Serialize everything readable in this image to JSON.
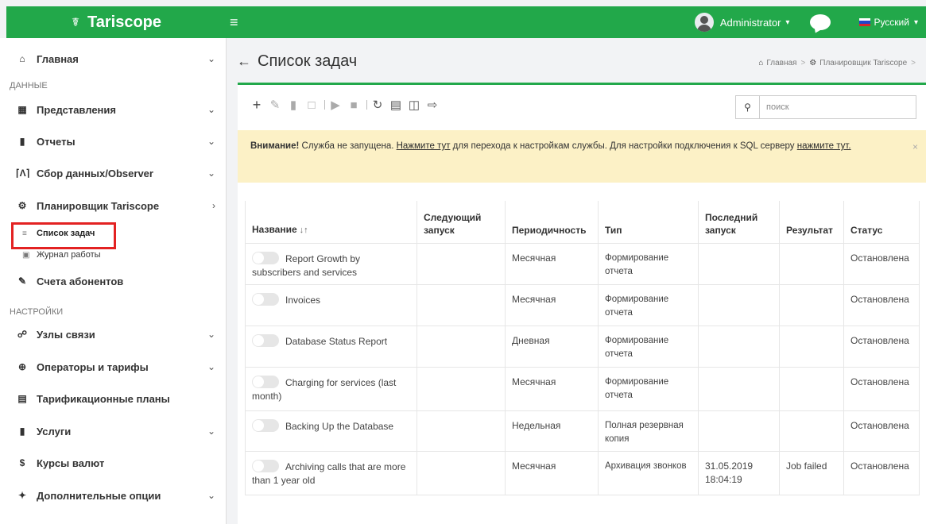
{
  "brand": {
    "name": "Tariscope",
    "glyph": "☤"
  },
  "topbar": {
    "menu_glyph": "≡",
    "user_name": "Administrator",
    "language": "Русский",
    "caret": "▾"
  },
  "sidebar": {
    "home": {
      "label": "Главная",
      "icon": "home-icon"
    },
    "section_data": "ДАННЫЕ",
    "views": {
      "label": "Представления",
      "icon": "table-icon"
    },
    "reports": {
      "label": "Отчеты",
      "icon": "book-icon"
    },
    "collection": {
      "label": "Сбор данных/Observer",
      "icon": "antenna-icon"
    },
    "scheduler": {
      "label": "Планировщик Tariscope",
      "icon": "cogs-icon"
    },
    "task_list": {
      "label": "Список задач",
      "icon": "list-icon"
    },
    "work_log": {
      "label": "Журнал работы",
      "icon": "log-icon"
    },
    "accounts": {
      "label": "Счета абонентов",
      "icon": "invoice-icon"
    },
    "section_settings": "НАСТРОЙКИ",
    "nodes": {
      "label": "Узлы связи",
      "icon": "nodes-icon"
    },
    "operators": {
      "label": "Операторы и тарифы",
      "icon": "globe-icon"
    },
    "tariff_plans": {
      "label": "Тарификационные планы",
      "icon": "plans-icon"
    },
    "services": {
      "label": "Услуги",
      "icon": "services-icon"
    },
    "currency": {
      "label": "Курсы валют",
      "icon": "dollar-icon"
    },
    "options": {
      "label": "Дополнительные опции",
      "icon": "pin-icon"
    }
  },
  "page": {
    "title": "Список задач",
    "breadcrumb": [
      "Главная",
      "Планировщик Tariscope"
    ]
  },
  "search": {
    "placeholder": "поиск",
    "value": ""
  },
  "alert": {
    "strong": "Внимание!",
    "text1": " Служба не запущена. ",
    "link1": "Нажмите тут",
    "text2": " для перехода к настройкам службы. Для настройки подключения к SQL серверу ",
    "link2": "нажмите тут."
  },
  "table": {
    "columns": [
      "Название",
      "Следующий запуск",
      "Периодичность",
      "Тип",
      "Последний запуск",
      "Результат",
      "Статус"
    ],
    "rows": [
      {
        "name": "Report Growth by subscribers and services",
        "next": "",
        "period": "Месячная",
        "type": "Формирование отчета",
        "last": "",
        "result": "",
        "status": "Остановлена"
      },
      {
        "name": "Invoices",
        "next": "",
        "period": "Месячная",
        "type": "Формирование отчета",
        "last": "",
        "result": "",
        "status": "Остановлена"
      },
      {
        "name": "Database Status Report",
        "next": "",
        "period": "Дневная",
        "type": "Формирование отчета",
        "last": "",
        "result": "",
        "status": "Остановлена"
      },
      {
        "name": "Charging for services (last month)",
        "next": "",
        "period": "Месячная",
        "type": "Формирование отчета",
        "last": "",
        "result": "",
        "status": "Остановлена"
      },
      {
        "name": "Backing Up the Database",
        "next": "",
        "period": "Недельная",
        "type": "Полная резервная копия",
        "last": "",
        "result": "",
        "status": "Остановлена"
      },
      {
        "name": "Archiving calls that are more than 1 year old",
        "next": "",
        "period": "Месячная",
        "type": "Архивация звонков",
        "last": "31.05.2019 18:04:19",
        "result": "Job failed",
        "status": "Остановлена"
      }
    ]
  },
  "colors": {
    "accent": "#22a84a",
    "alert_bg": "#fcf1c6",
    "highlight": "#e32222"
  }
}
